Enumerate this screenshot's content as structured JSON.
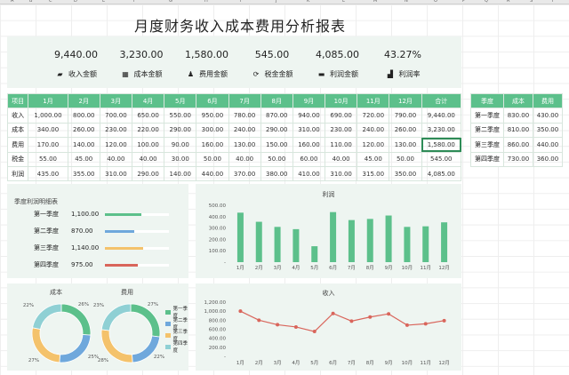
{
  "title": "月度财务收入成本费用分析报表",
  "columns": [
    "A",
    "B",
    "C",
    "D",
    "E",
    "F",
    "G",
    "H",
    "I",
    "J",
    "K",
    "L",
    "M",
    "N",
    "O",
    "P",
    "Q",
    "R",
    "S",
    "T"
  ],
  "kpis": [
    {
      "value": "9,440.00",
      "label": "收入金额",
      "icon": "wallet-icon"
    },
    {
      "value": "3,230.00",
      "label": "成本金额",
      "icon": "calculator-icon"
    },
    {
      "value": "1,580.00",
      "label": "费用金额",
      "icon": "people-icon"
    },
    {
      "value": "545.00",
      "label": "税金金额",
      "icon": "refresh-money-icon"
    },
    {
      "value": "4,085.00",
      "label": "利润金额",
      "icon": "folder-money-icon"
    },
    {
      "value": "43.27%",
      "label": "利润率",
      "icon": "growth-chart-icon"
    }
  ],
  "monthly": {
    "headers": [
      "项目",
      "1月",
      "2月",
      "3月",
      "4月",
      "5月",
      "6月",
      "7月",
      "8月",
      "9月",
      "10月",
      "11月",
      "12月",
      "合计"
    ],
    "rows": [
      [
        "收入",
        "1,000.00",
        "800.00",
        "700.00",
        "650.00",
        "550.00",
        "950.00",
        "780.00",
        "870.00",
        "940.00",
        "690.00",
        "720.00",
        "790.00",
        "9,440.00"
      ],
      [
        "成本",
        "340.00",
        "260.00",
        "230.00",
        "220.00",
        "290.00",
        "300.00",
        "240.00",
        "290.00",
        "310.00",
        "230.00",
        "240.00",
        "260.00",
        "3,230.00"
      ],
      [
        "费用",
        "170.00",
        "140.00",
        "120.00",
        "100.00",
        "90.00",
        "160.00",
        "130.00",
        "150.00",
        "160.00",
        "110.00",
        "120.00",
        "130.00",
        "1,580.00"
      ],
      [
        "税金",
        "55.00",
        "45.00",
        "40.00",
        "40.00",
        "30.00",
        "50.00",
        "40.00",
        "50.00",
        "60.00",
        "40.00",
        "45.00",
        "50.00",
        "545.00"
      ],
      [
        "利润",
        "435.00",
        "355.00",
        "310.00",
        "290.00",
        "140.00",
        "440.00",
        "370.00",
        "380.00",
        "410.00",
        "310.00",
        "315.00",
        "350.00",
        "4,085.00"
      ]
    ]
  },
  "quarterly": {
    "headers": [
      "季度",
      "成本",
      "费用"
    ],
    "rows": [
      [
        "第一季度",
        "830.00",
        "430.00"
      ],
      [
        "第二季度",
        "810.00",
        "350.00"
      ],
      [
        "第三季度",
        "860.00",
        "440.00"
      ],
      [
        "第四季度",
        "730.00",
        "360.00"
      ]
    ]
  },
  "profit_detail": {
    "title": "季度利润明细表",
    "items": [
      {
        "quarter": "第一季度",
        "value": "1,100.00",
        "pct": 0.96,
        "color": "#5cc08b"
      },
      {
        "quarter": "第二季度",
        "value": "870.00",
        "pct": 0.76,
        "color": "#6fa8dc"
      },
      {
        "quarter": "第三季度",
        "value": "1,140.00",
        "pct": 1.0,
        "color": "#f4c26b"
      },
      {
        "quarter": "第四季度",
        "value": "975.00",
        "pct": 0.85,
        "color": "#d9655b"
      }
    ]
  },
  "chart_data": [
    {
      "type": "bar",
      "title": "利润",
      "categories": [
        "1月",
        "2月",
        "3月",
        "4月",
        "5月",
        "6月",
        "7月",
        "8月",
        "9月",
        "10月",
        "11月",
        "12月"
      ],
      "values": [
        435,
        355,
        310,
        290,
        140,
        440,
        370,
        380,
        410,
        310,
        315,
        350
      ],
      "yticks": [
        "500.00",
        "400.00",
        "300.00",
        "200.00",
        "100.00",
        "-"
      ],
      "ylim": [
        0,
        500
      ],
      "color": "#5cc08b"
    },
    {
      "type": "line",
      "title": "收入",
      "categories": [
        "1月",
        "2月",
        "3月",
        "4月",
        "5月",
        "6月",
        "7月",
        "8月",
        "9月",
        "10月",
        "11月",
        "12月"
      ],
      "values": [
        1000,
        800,
        700,
        650,
        550,
        950,
        780,
        870,
        940,
        690,
        720,
        790
      ],
      "yticks": [
        "1,200.00",
        "1,000.00",
        "800.00",
        "600.00",
        "400.00",
        "200.00",
        "-"
      ],
      "ylim": [
        0,
        1200
      ],
      "color": "#d9655b"
    },
    {
      "type": "pie",
      "title": "成本",
      "categories": [
        "第一季度",
        "第二季度",
        "第三季度",
        "第四季度"
      ],
      "values": [
        26,
        25,
        27,
        22
      ],
      "labels": [
        "26%",
        "25%",
        "27%",
        "22%"
      ]
    },
    {
      "type": "pie",
      "title": "费用",
      "categories": [
        "第一季度",
        "第二季度",
        "第三季度",
        "第四季度"
      ],
      "values": [
        27,
        22,
        28,
        23
      ],
      "labels": [
        "27%",
        "22%",
        "28%",
        "23%"
      ]
    }
  ],
  "donut_legend": [
    "第一季度",
    "第二季度",
    "第三季度",
    "第四季度"
  ],
  "donut_colors": [
    "#5cc08b",
    "#6fa8dc",
    "#f4c26b",
    "#8fd0d4"
  ]
}
